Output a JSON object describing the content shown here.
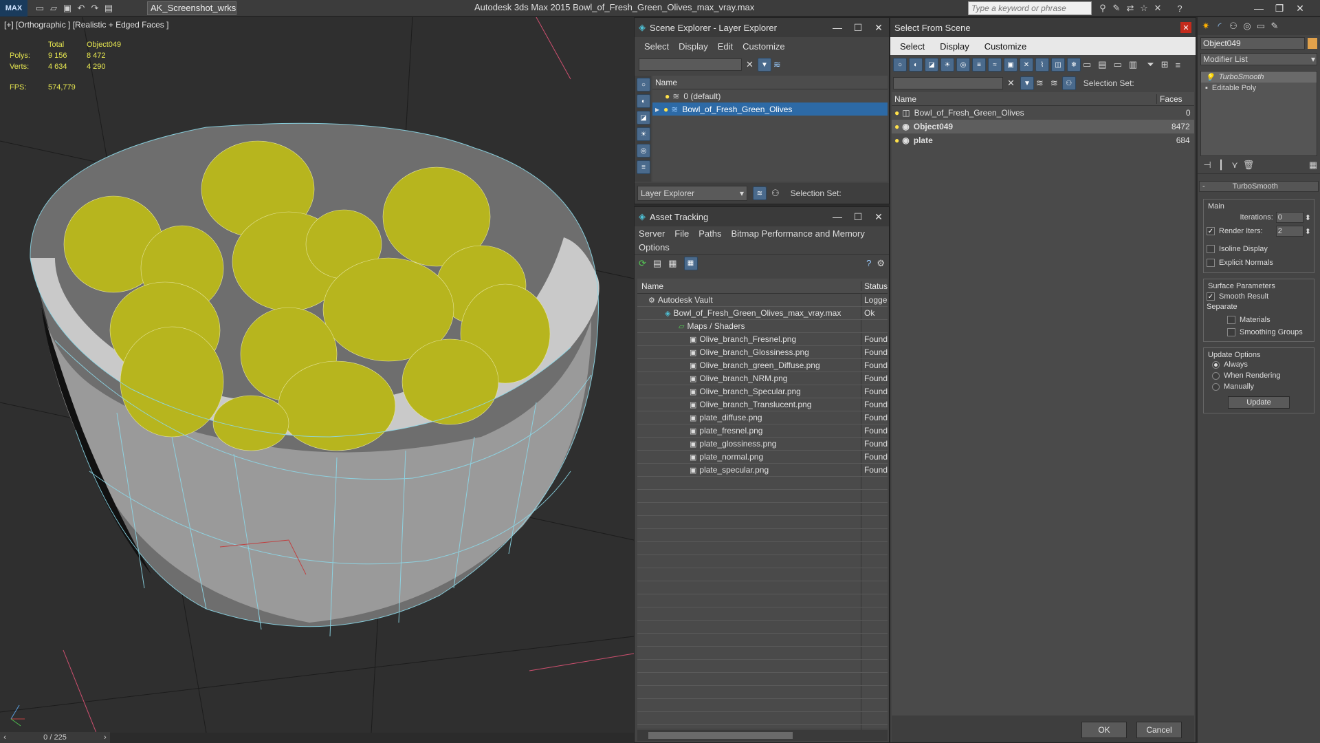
{
  "titlebar": {
    "logo": "MAX",
    "workspace": "AK_Screenshot_wrksp",
    "app_title": "Autodesk 3ds Max  2015    Bowl_of_Fresh_Green_Olives_max_vray.max",
    "search_placeholder": "Type a keyword or phrase"
  },
  "viewport": {
    "label": "[+] [Orthographic ] [Realistic + Edged Faces ]",
    "stats": {
      "header_total": "Total",
      "header_object": "Object049",
      "polys_label": "Polys:",
      "polys_total": "9 156",
      "polys_object": "8 472",
      "verts_label": "Verts:",
      "verts_total": "4 634",
      "verts_object": "4 290",
      "fps_label": "FPS:",
      "fps_value": "574,779"
    }
  },
  "bottombar": {
    "frame": "0 / 225"
  },
  "scene_explorer": {
    "title": "Scene Explorer - Layer Explorer",
    "menu": [
      "Select",
      "Display",
      "Edit",
      "Customize"
    ],
    "column_name": "Name",
    "rows": [
      "0 (default)",
      "Bowl_of_Fresh_Green_Olives"
    ],
    "footer_label": "Layer Explorer",
    "selection_set": "Selection Set:"
  },
  "asset_tracking": {
    "title": "Asset Tracking",
    "menu": [
      "Server",
      "File",
      "Paths",
      "Bitmap Performance and Memory"
    ],
    "menu2": "Options",
    "col_name": "Name",
    "col_status": "Status",
    "rows": [
      {
        "name": "Autodesk Vault",
        "status": "Logge"
      },
      {
        "name": "Bowl_of_Fresh_Green_Olives_max_vray.max",
        "status": "Ok"
      },
      {
        "name": "Maps / Shaders",
        "status": ""
      },
      {
        "name": "Olive_branch_Fresnel.png",
        "status": "Found"
      },
      {
        "name": "Olive_branch_Glossiness.png",
        "status": "Found"
      },
      {
        "name": "Olive_branch_green_Diffuse.png",
        "status": "Found"
      },
      {
        "name": "Olive_branch_NRM.png",
        "status": "Found"
      },
      {
        "name": "Olive_branch_Specular.png",
        "status": "Found"
      },
      {
        "name": "Olive_branch_Translucent.png",
        "status": "Found"
      },
      {
        "name": "plate_diffuse.png",
        "status": "Found"
      },
      {
        "name": "plate_fresnel.png",
        "status": "Found"
      },
      {
        "name": "plate_glossiness.png",
        "status": "Found"
      },
      {
        "name": "plate_normal.png",
        "status": "Found"
      },
      {
        "name": "plate_specular.png",
        "status": "Found"
      }
    ]
  },
  "select_from_scene": {
    "title": "Select From Scene",
    "menu": [
      "Select",
      "Display",
      "Customize"
    ],
    "selection_set": "Selection Set:",
    "col_name": "Name",
    "col_faces": "Faces",
    "rows": [
      {
        "name": "Bowl_of_Fresh_Green_Olives",
        "faces": "0"
      },
      {
        "name": "Object049",
        "faces": "8472"
      },
      {
        "name": "plate",
        "faces": "684"
      }
    ],
    "ok": "OK",
    "cancel": "Cancel"
  },
  "command_panel": {
    "object_name": "Object049",
    "modifier_list": "Modifier List",
    "stack": [
      "TurboSmooth",
      "Editable Poly"
    ],
    "rollout_title": "TurboSmooth",
    "main_label": "Main",
    "iterations_label": "Iterations:",
    "iterations_value": "0",
    "render_iters_label": "Render Iters:",
    "render_iters_value": "2",
    "isoline": "Isoline Display",
    "explicit_normals": "Explicit Normals",
    "surface_params": "Surface Parameters",
    "smooth_result": "Smooth Result",
    "separate": "Separate",
    "materials": "Materials",
    "smoothing_groups": "Smoothing Groups",
    "update_options": "Update Options",
    "always": "Always",
    "when_rendering": "When Rendering",
    "manually": "Manually",
    "update_button": "Update"
  },
  "colors": {
    "olive": "#b7b51e",
    "selection": "#2d6aa6",
    "stats_text": "#e8e850"
  }
}
